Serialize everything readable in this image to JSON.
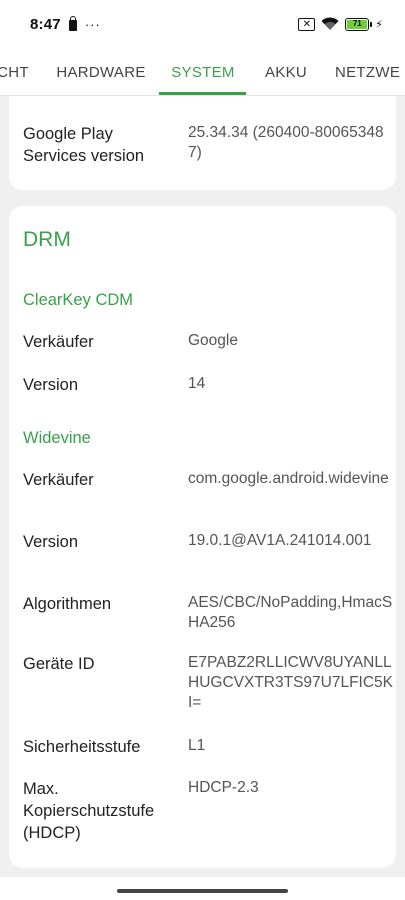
{
  "status_bar": {
    "time": "8:47",
    "more": "···",
    "battery_level": "71",
    "icons": [
      "lock-icon",
      "no-sim-icon",
      "wifi-icon",
      "battery-icon",
      "charging-icon"
    ]
  },
  "tabs": [
    {
      "label": "CHT"
    },
    {
      "label": "HARDWARE"
    },
    {
      "label": "SYSTEM"
    },
    {
      "label": "AKKU"
    },
    {
      "label": "NETZWE"
    }
  ],
  "active_tab": "SYSTEM",
  "accent_color": "#3aa14a",
  "top_card": {
    "label": "Google Play Services version",
    "value": "25.34.34 (260400-800653487)"
  },
  "drm": {
    "title": "DRM",
    "clearkey": {
      "title": "ClearKey CDM",
      "vendor_label": "Verkäufer",
      "vendor_value": "Google",
      "version_label": "Version",
      "version_value": "14"
    },
    "widevine": {
      "title": "Widevine",
      "vendor_label": "Verkäufer",
      "vendor_value": "com.google.android.widevine",
      "version_label": "Version",
      "version_value": "19.0.1@AV1A.241014.001",
      "algorithms_label": "Algorithmen",
      "algorithms_value": "AES/CBC/NoPadding,HmacSHA256",
      "device_id_label": "Geräte ID",
      "device_id_value": "E7PABZ2RLLICWV8UYANLLHUGCVXTR3TS97U7LFIC5KI=",
      "security_label": "Sicherheitsstufe",
      "security_value": "L1",
      "hdcp_label": "Max. Kopierschutzstufe (HDCP)",
      "hdcp_value": "HDCP-2.3"
    }
  }
}
